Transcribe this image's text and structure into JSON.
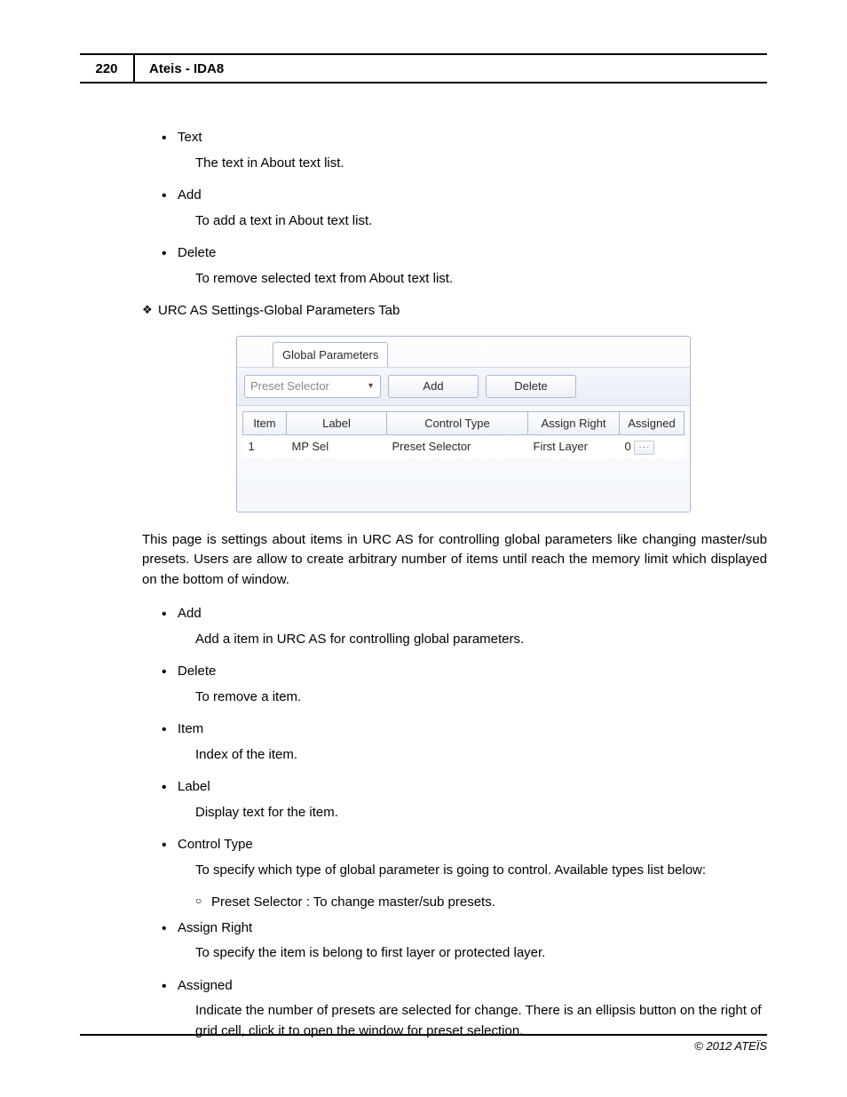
{
  "header": {
    "page_number": "220",
    "doc_title": "Ateis - IDA8"
  },
  "section1": {
    "items": [
      {
        "term": "Text",
        "desc": "The text in About text list."
      },
      {
        "term": "Add",
        "desc": "To add a text in About text list."
      },
      {
        "term": "Delete",
        "desc": "To remove selected text from About text list."
      }
    ]
  },
  "heading2": "URC AS Settings-Global Parameters Tab",
  "ui": {
    "tab_label": "Global Parameters",
    "combo_placeholder": "Preset Selector",
    "btn_add": "Add",
    "btn_delete": "Delete",
    "columns": {
      "item": "Item",
      "label": "Label",
      "ctrl": "Control Type",
      "right": "Assign Right",
      "assigned": "Assigned"
    },
    "rows": [
      {
        "item": "1",
        "label": "MP Sel",
        "ctrl": "Preset Selector",
        "right": "First Layer",
        "assigned": "0"
      }
    ]
  },
  "paragraph2": "This page is settings about items in URC AS for controlling global parameters like changing master/sub presets. Users are allow to create arbitrary number of items until reach the memory limit which displayed on the bottom of window.",
  "section2": {
    "items": [
      {
        "term": "Add",
        "desc": "Add a item in URC AS for controlling global parameters."
      },
      {
        "term": "Delete",
        "desc": "To remove a item."
      },
      {
        "term": "Item",
        "desc": "Index of the item."
      },
      {
        "term": "Label",
        "desc": "Display text for the item."
      },
      {
        "term": "Control Type",
        "desc": "To specify which type of global parameter is going to control. Available types list below:",
        "sub": [
          "Preset Selector : To change master/sub presets."
        ]
      },
      {
        "term": "Assign Right",
        "desc": "To specify the item is belong to first layer or protected layer."
      },
      {
        "term": "Assigned",
        "desc": "Indicate the number of presets are selected for change. There is an ellipsis button on the right of grid cell, click it to open the window for preset selection."
      }
    ]
  },
  "footer": "© 2012 ATEÏS"
}
